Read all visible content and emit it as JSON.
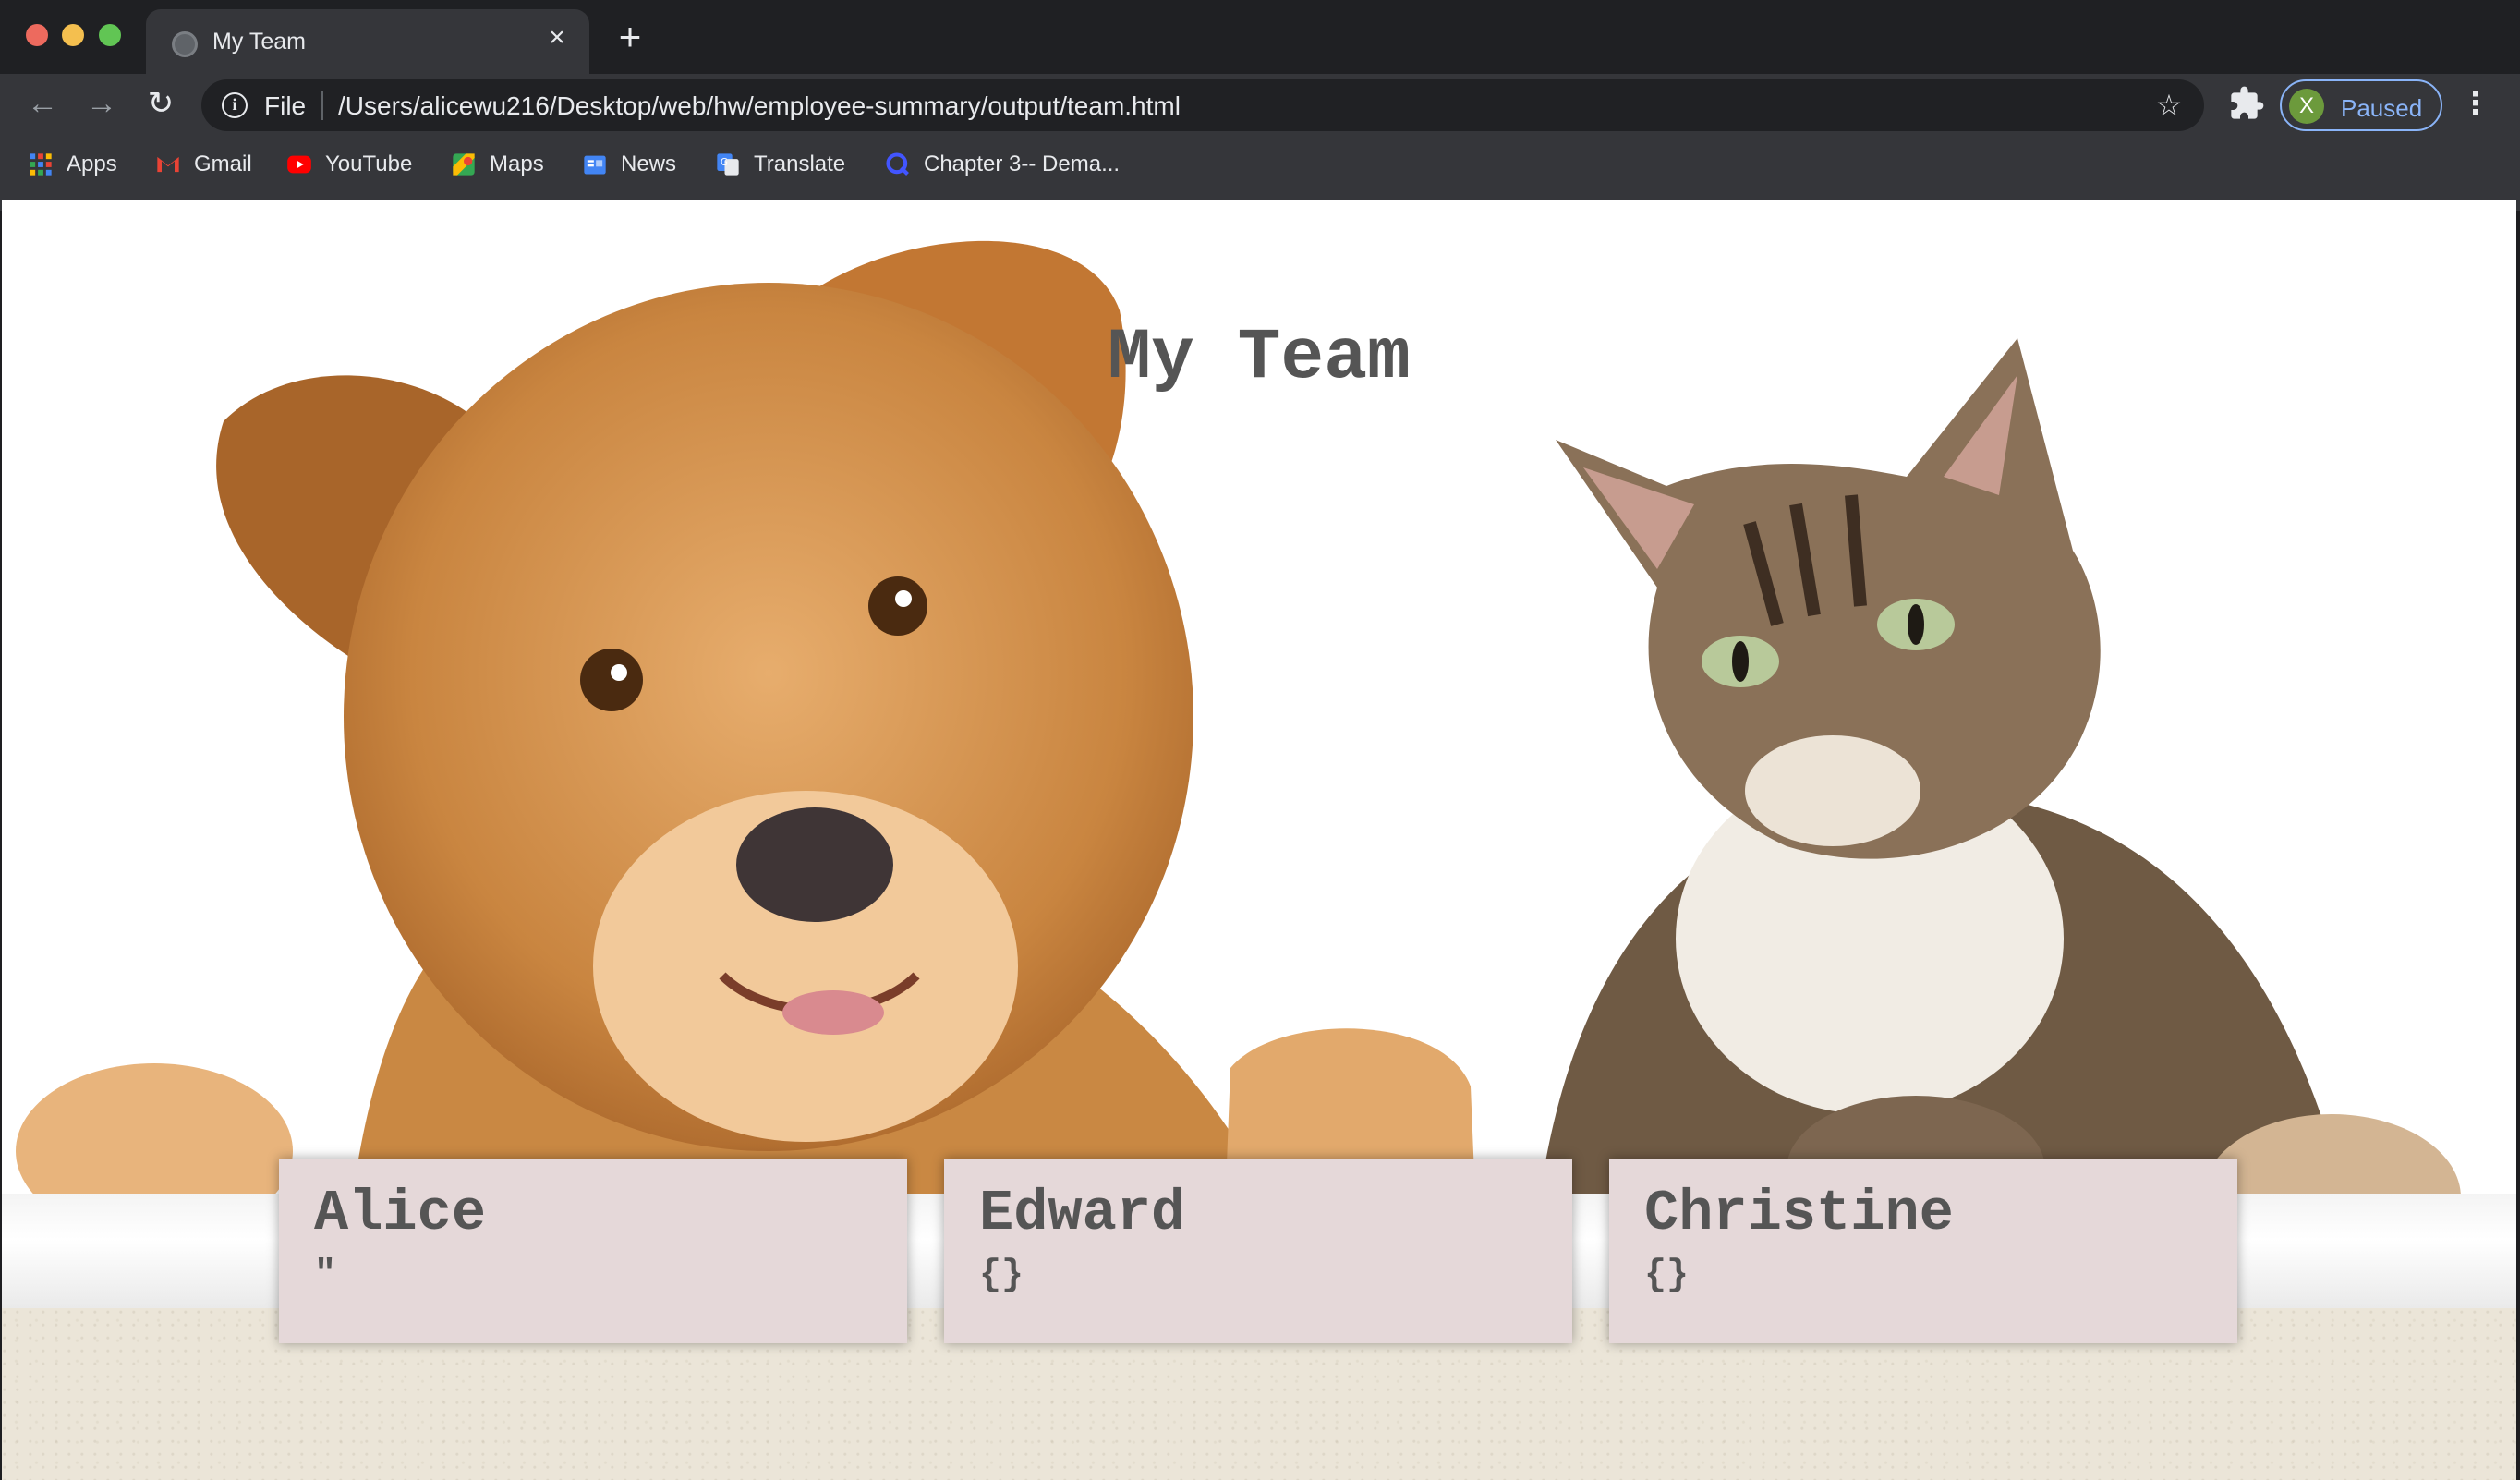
{
  "browser": {
    "tab": {
      "title": "My Team"
    },
    "address_bar": {
      "scheme_label": "File",
      "url": "/Users/alicewu216/Desktop/web/hw/employee-summary/output/team.html"
    },
    "profile": {
      "initial": "X",
      "status": "Paused"
    },
    "bookmarks": [
      {
        "label": "Apps",
        "icon": "apps-grid-icon"
      },
      {
        "label": "Gmail",
        "icon": "gmail-icon"
      },
      {
        "label": "YouTube",
        "icon": "youtube-icon"
      },
      {
        "label": "Maps",
        "icon": "maps-icon"
      },
      {
        "label": "News",
        "icon": "news-icon"
      },
      {
        "label": "Translate",
        "icon": "translate-icon"
      },
      {
        "label": "Chapter 3-- Dema...",
        "icon": "quizlet-icon"
      }
    ]
  },
  "page": {
    "title": "My Team",
    "hero_image": "dog-and-cat-photo",
    "cards": [
      {
        "name": "Alice",
        "partial_text": "\""
      },
      {
        "name": "Edward",
        "partial_text": "{}"
      },
      {
        "name": "Christine",
        "partial_text": "{}"
      }
    ]
  },
  "colors": {
    "chrome_bg": "#35363a",
    "tabstrip_bg": "#1f2023",
    "profile_accent": "#8ab4f8",
    "card_bg": "#e5d8d9",
    "heading_text": "#555555"
  }
}
